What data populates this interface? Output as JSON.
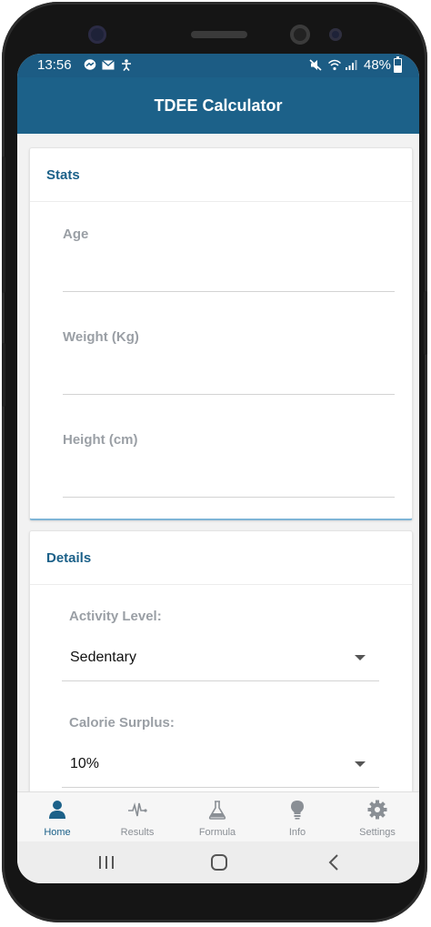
{
  "status_bar": {
    "time": "13:56",
    "battery": "48%",
    "battery_level": 0.48,
    "notification_icons": [
      "messenger-icon",
      "mail-icon",
      "accessibility-icon"
    ],
    "system_icons": [
      "mute-icon",
      "wifi-icon",
      "signal-icon",
      "battery-icon"
    ]
  },
  "app": {
    "title": "TDEE Calculator"
  },
  "stats": {
    "header": "Stats",
    "age": {
      "label": "Age",
      "value": ""
    },
    "weight": {
      "label": "Weight (Kg)",
      "value": ""
    },
    "height": {
      "label": "Height (cm)",
      "value": ""
    }
  },
  "details": {
    "header": "Details",
    "activity": {
      "label": "Activity Level:",
      "value": "Sedentary"
    },
    "surplus": {
      "label": "Calorie Surplus:",
      "value": "10%"
    }
  },
  "tabs": [
    {
      "label": "Home",
      "icon": "person-icon",
      "active": true
    },
    {
      "label": "Results",
      "icon": "pulse-icon",
      "active": false
    },
    {
      "label": "Formula",
      "icon": "flask-icon",
      "active": false
    },
    {
      "label": "Info",
      "icon": "lightbulb-icon",
      "active": false
    },
    {
      "label": "Settings",
      "icon": "gear-icon",
      "active": false
    }
  ],
  "nav_buttons": [
    "recents-icon",
    "home-icon",
    "back-icon"
  ],
  "colors": {
    "primary": "#1c6189",
    "status_bar": "#1c5c84",
    "inactive": "#8a8f95",
    "label": "#9a9fa5"
  }
}
